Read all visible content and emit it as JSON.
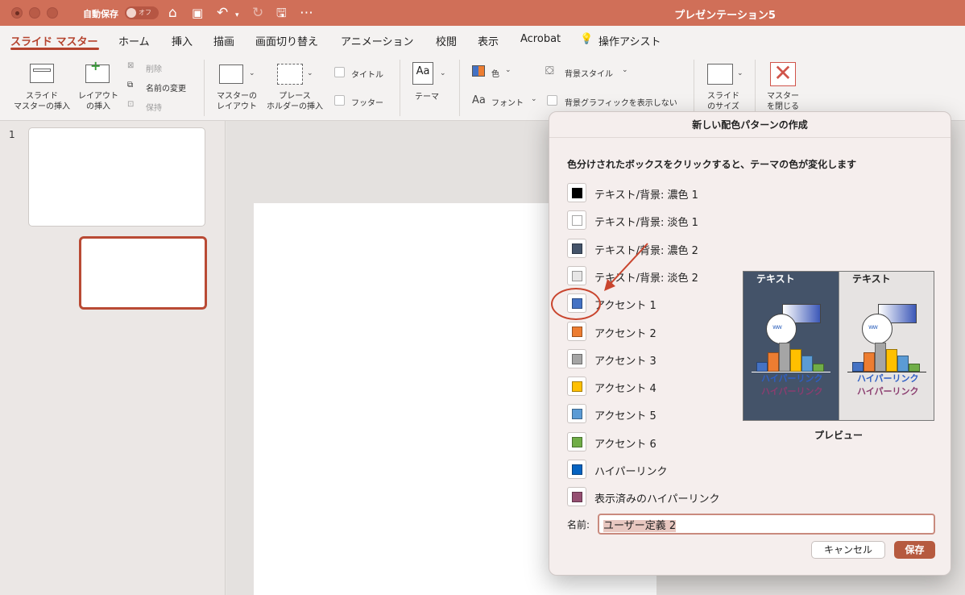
{
  "titlebar": {
    "autosave_label": "自動保存",
    "autosave_state": "オフ",
    "doc_title": "プレゼンテーション5"
  },
  "tabs": [
    "スライド マスター",
    "ホーム",
    "挿入",
    "描画",
    "画面切り替え",
    "アニメーション",
    "校閲",
    "表示",
    "Acrobat",
    "操作アシスト"
  ],
  "ribbon": {
    "insert_slide_master": "スライド\nマスターの挿入",
    "insert_layout": "レイアウト\nの挿入",
    "delete": "削除",
    "rename": "名前の変更",
    "preserve": "保持",
    "master_layout": "マスターの\nレイアウト",
    "insert_placeholder": "プレース\nホルダーの挿入",
    "title_chk": "タイトル",
    "footer_chk": "フッター",
    "theme": "テーマ",
    "colors": "色",
    "fonts": "フォント",
    "background_styles": "背景スタイル",
    "hide_background_graphics": "背景グラフィックを表示しない",
    "slide_size": "スライド\nのサイズ",
    "close_master": "マスター\nを閉じる"
  },
  "slides": {
    "number": "1"
  },
  "dialog": {
    "title": "新しい配色パターンの作成",
    "instruction": "色分けされたボックスをクリックすると、テーマの色が変化します",
    "colors": [
      {
        "label": "テキスト/背景: 濃色 1",
        "color": "#000000"
      },
      {
        "label": "テキスト/背景: 淡色 1",
        "color": "#FFFFFF"
      },
      {
        "label": "テキスト/背景: 濃色 2",
        "color": "#44546A"
      },
      {
        "label": "テキスト/背景: 淡色 2",
        "color": "#E7E6E6"
      },
      {
        "label": "アクセント 1",
        "color": "#4472C4"
      },
      {
        "label": "アクセント 2",
        "color": "#ED7D31"
      },
      {
        "label": "アクセント 3",
        "color": "#A5A5A5"
      },
      {
        "label": "アクセント 4",
        "color": "#FFC000"
      },
      {
        "label": "アクセント 5",
        "color": "#5B9BD5"
      },
      {
        "label": "アクセント 6",
        "color": "#70AD47"
      },
      {
        "label": "ハイパーリンク",
        "color": "#0563C1"
      },
      {
        "label": "表示済みのハイパーリンク",
        "color": "#954F72"
      }
    ],
    "preview": {
      "text_label": "テキスト",
      "hyperlink": "ハイパーリンク",
      "visited_hyperlink": "ハイパーリンク",
      "caption": "プレビュー"
    },
    "name_label": "名前:",
    "name_value": "ユーザー定義 2",
    "cancel": "キャンセル",
    "save": "保存"
  },
  "colors": {
    "titlebar": "#D06F58",
    "accent": "#B5432E",
    "annotation": "#C9452E"
  }
}
